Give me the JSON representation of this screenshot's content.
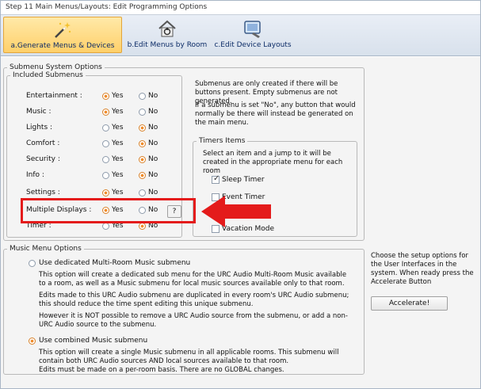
{
  "window": {
    "title": "Step 11 Main Menus/Layouts: Edit Programming Options"
  },
  "ribbon": {
    "buttons": [
      {
        "label": "a.Generate Menus & Devices",
        "icon": "magic-wand-icon",
        "active": true
      },
      {
        "label": "b.Edit Menus by Room",
        "icon": "room-menu-icon",
        "active": false
      },
      {
        "label": "c.Edit Device Layouts",
        "icon": "device-layout-icon",
        "active": false
      }
    ]
  },
  "submenu": {
    "legend": "Submenu System Options",
    "included_legend": "Included Submenus",
    "rows": [
      {
        "label": "Entertainment :",
        "selected": "Yes"
      },
      {
        "label": "Music :",
        "selected": "Yes"
      },
      {
        "label": "Lights :",
        "selected": "No"
      },
      {
        "label": "Comfort :",
        "selected": "No"
      },
      {
        "label": "Security :",
        "selected": "No"
      },
      {
        "label": "Info :",
        "selected": "No"
      },
      {
        "label": "Settings :",
        "selected": "Yes"
      },
      {
        "label": "Multiple Displays :",
        "selected": "Yes"
      },
      {
        "label": "Timer :",
        "selected": "No"
      }
    ],
    "yes": "Yes",
    "no": "No",
    "help_button": "?",
    "note1": "Submenus are only created if there will be buttons present. Empty submenus are not generated.",
    "note2": "If a submenu is set \"No\", any button that would normally be there will instead be generated on the main menu."
  },
  "timers": {
    "legend": "Timers Items",
    "desc": "Select an item and a jump to it will be created in the appropriate menu for each room",
    "items": [
      {
        "label": "Sleep Timer",
        "checked": true
      },
      {
        "label": "Event Timer",
        "checked": false
      },
      {
        "label": "Vacation Mode",
        "checked": false
      }
    ]
  },
  "music": {
    "legend": "Music Menu Options",
    "option1_label": "Use dedicated Multi-Room Music submenu",
    "option1_p1": "This option will create a dedicated sub menu for the URC Audio Multi-Room Music available to a room, as well as a Music submenu for local music sources available only to that room.",
    "option1_p2": "Edits made to this URC Audio submenu are duplicated in every room's URC Audio submenu; this should reduce the time spent editing this unique submenu.",
    "option1_p3": "However it is NOT possible to remove a URC Audio source from the submenu, or add a non-URC Audio source to the submenu.",
    "option2_label": "Use combined Music submenu",
    "option2_p1": "This option will create a single Music submenu in all applicable rooms. This submenu will contain both URC Audio sources AND local sources available to that room.",
    "option2_p2": "Edits must be made on a per-room basis. There are no GLOBAL changes.",
    "selected": 2
  },
  "side": {
    "info": "Choose the setup options for the User Interfaces in the system. When ready press the Accelerate Button",
    "accelerate": "Accelerate!"
  },
  "colors": {
    "highlight": "#e41b1b",
    "radio_on": "#f08d2d"
  }
}
